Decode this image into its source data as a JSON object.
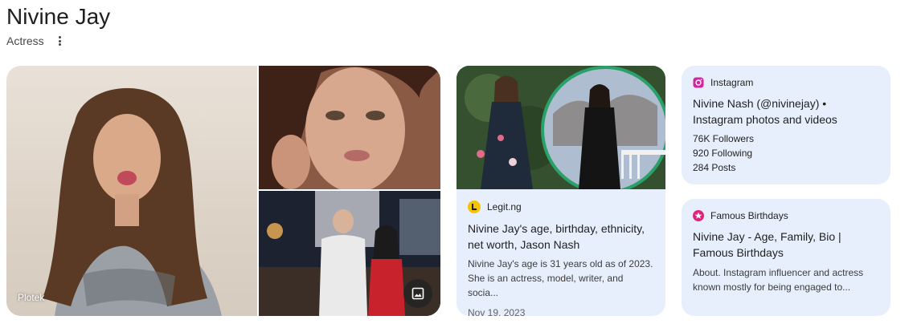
{
  "header": {
    "title": "Nivine Jay",
    "subtitle": "Actress"
  },
  "images": {
    "main_credit": "Plotek"
  },
  "cards": {
    "legit": {
      "source": "Legit.ng",
      "title": "Nivine Jay's age, birthday, ethnicity, net worth, Jason Nash",
      "snippet_line1": "Nivine Jay's age is 31 years old as of 2023.",
      "snippet_line2": "She is an actress, model, writer, and socia...",
      "date": "Nov 19, 2023"
    },
    "instagram": {
      "source": "Instagram",
      "title": "Nivine Nash (@nivinejay) • Instagram photos and videos",
      "followers": "76K Followers",
      "following": "920 Following",
      "posts": "284 Posts"
    },
    "famous_birthdays": {
      "source": "Famous Birthdays",
      "title": "Nivine Jay - Age, Family, Bio | Famous Birthdays",
      "snippet_line1": "About. Instagram influencer and actress",
      "snippet_line2": "known mostly for being engaged to..."
    }
  },
  "colors": {
    "card_bg": "#e8effc",
    "legit_logo": "#f5c400",
    "instagram_logo": "#d6249f",
    "famous_birthdays_logo": "#e0237a"
  }
}
